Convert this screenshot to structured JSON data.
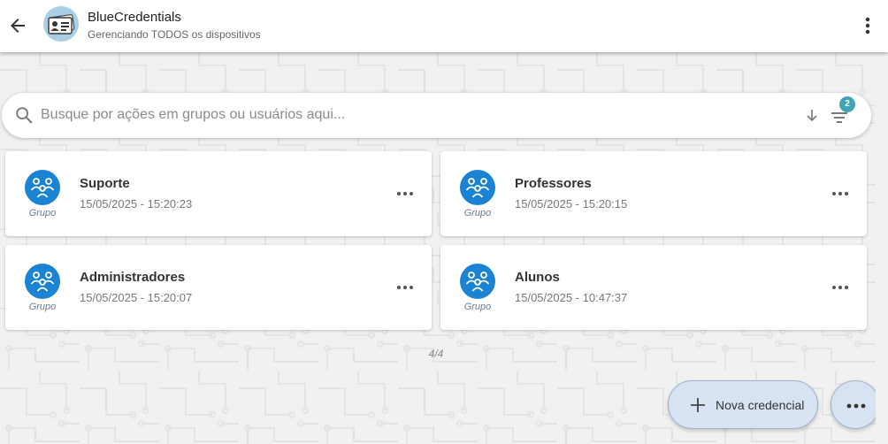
{
  "appbar": {
    "title": "BlueCredentials",
    "subtitle": "Gerenciando TODOS os dispositivos"
  },
  "search": {
    "placeholder": "Busque por ações em grupos ou usuários aqui...",
    "value": "",
    "filter_badge": "2"
  },
  "cards": [
    {
      "type_label": "Grupo",
      "name": "Suporte",
      "date": "15/05/2025 - 15:20:23"
    },
    {
      "type_label": "Grupo",
      "name": "Professores",
      "date": "15/05/2025 - 15:20:15"
    },
    {
      "type_label": "Grupo",
      "name": "Administradores",
      "date": "15/05/2025 - 15:20:07"
    },
    {
      "type_label": "Grupo",
      "name": "Alunos",
      "date": "15/05/2025 - 10:47:37"
    }
  ],
  "pager": "4/4",
  "actions": {
    "new_credential_label": "Nova credencial"
  },
  "icons": {
    "back": "arrow-left-icon",
    "menu": "more-vert-icon",
    "search": "search-icon",
    "sort": "arrow-down-icon",
    "filter": "filter-list-icon",
    "group": "group-icon",
    "card_menu": "more-horiz-icon",
    "add": "plus-icon"
  },
  "colors": {
    "accent": "#1a83d4",
    "badge": "#3fa6b5",
    "fab": "#d7e3f2"
  }
}
